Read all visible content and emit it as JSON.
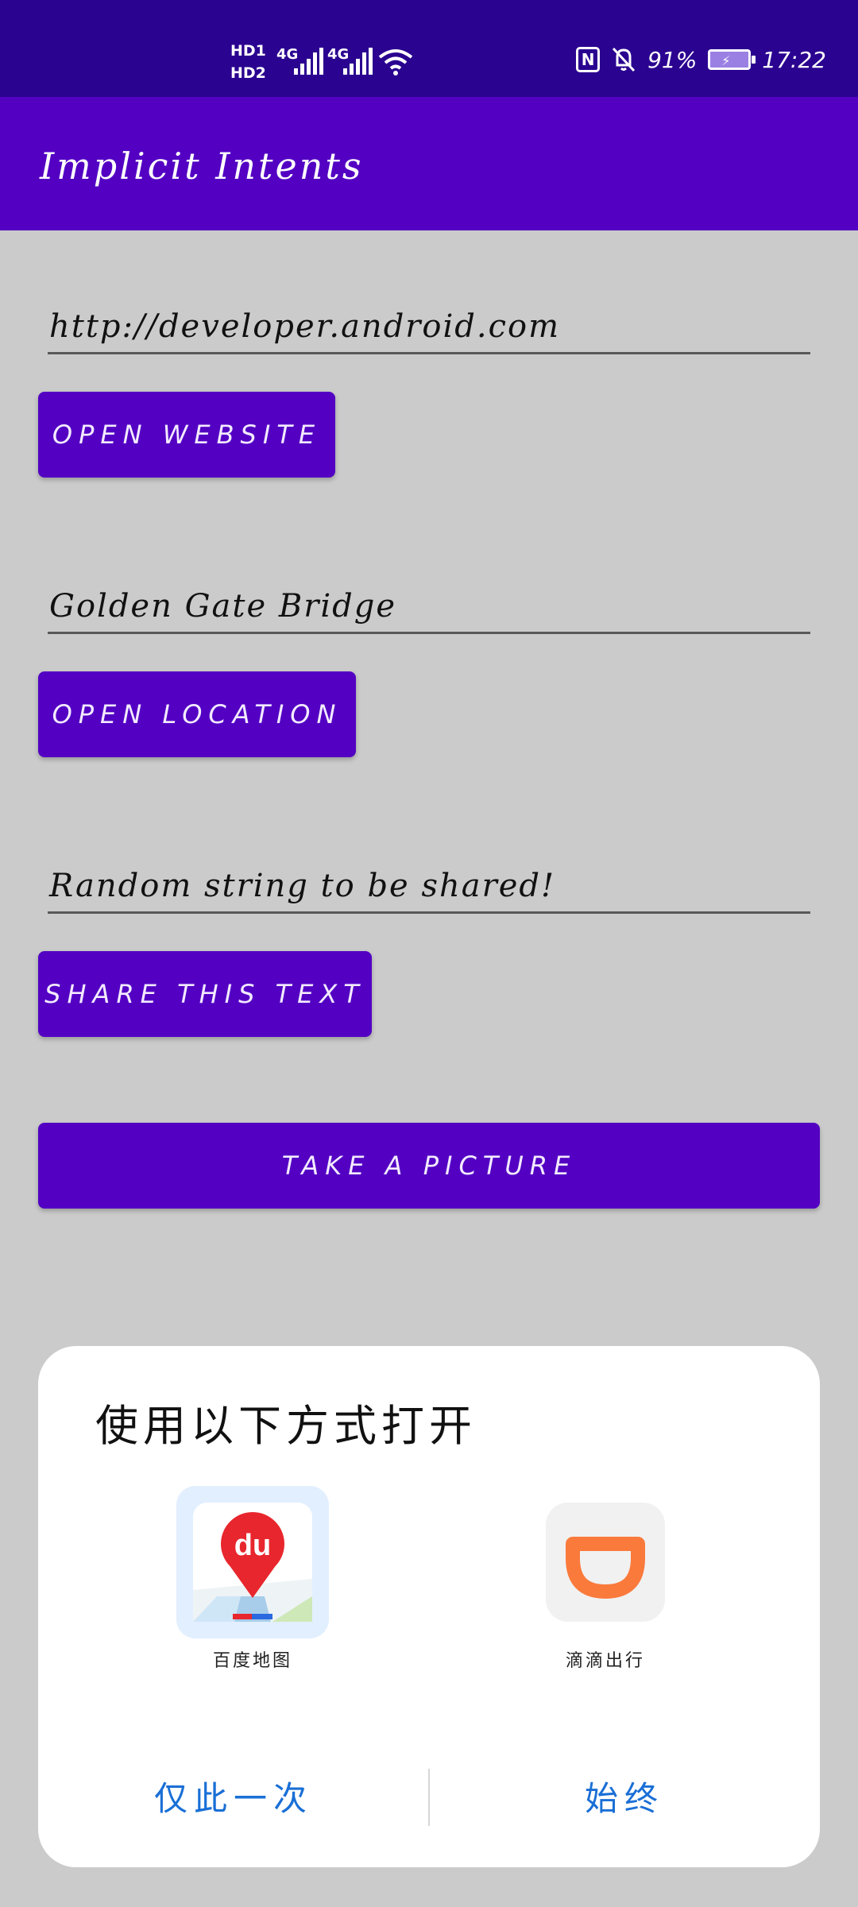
{
  "status_bar": {
    "hd1": "HD1",
    "hd2": "HD2",
    "net1": "4G",
    "net2": "4G",
    "nfc_label": "N",
    "battery_percent": "91%",
    "time": "17:22"
  },
  "app_bar": {
    "title": "Implicit Intents"
  },
  "website": {
    "value": "http://developer.android.com",
    "button": "OPEN WEBSITE"
  },
  "location": {
    "value": "Golden Gate Bridge",
    "button": "OPEN LOCATION"
  },
  "share": {
    "value": "Random string to be shared!",
    "button": "SHARE THIS TEXT"
  },
  "camera": {
    "button": "TAKE A PICTURE"
  },
  "chooser": {
    "title": "使用以下方式打开",
    "apps": [
      {
        "label": "百度地图",
        "icon_text": "du",
        "icon": "baidu-maps-icon"
      },
      {
        "label": "滴滴出行",
        "icon": "didi-icon"
      }
    ],
    "just_once": "仅此一次",
    "always": "始终"
  },
  "colors": {
    "status_bar": "#2a0390",
    "primary": "#5300c3",
    "background": "#cbcbcc",
    "dialog_action": "#1a6fd6"
  }
}
